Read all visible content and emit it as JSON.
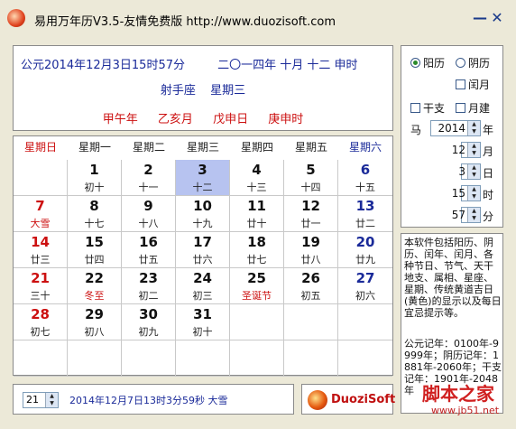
{
  "window": {
    "title": "易用万年历V3.5-友情免费版 http://www.duozisoft.com",
    "minimize": "—",
    "close": "✕"
  },
  "info": {
    "solar_datetime": "公元2014年12月3日15时57分",
    "lunar_date": "二〇一四年 十月 十二 申时",
    "constellation": "射手座",
    "weekday": "星期三",
    "ganzhi": [
      "甲午年",
      "乙亥月",
      "戊申日",
      "庚申时"
    ]
  },
  "weekdays": [
    "星期日",
    "星期一",
    "星期二",
    "星期三",
    "星期四",
    "星期五",
    "星期六"
  ],
  "calendar": {
    "today": "3",
    "days": [
      {
        "d": "",
        "l": ""
      },
      {
        "d": "1",
        "l": "初十"
      },
      {
        "d": "2",
        "l": "十一"
      },
      {
        "d": "3",
        "l": "十二"
      },
      {
        "d": "4",
        "l": "十三"
      },
      {
        "d": "5",
        "l": "十四"
      },
      {
        "d": "6",
        "l": "十五"
      },
      {
        "d": "7",
        "l": "大雪"
      },
      {
        "d": "8",
        "l": "十七"
      },
      {
        "d": "9",
        "l": "十八"
      },
      {
        "d": "10",
        "l": "十九"
      },
      {
        "d": "11",
        "l": "廿十"
      },
      {
        "d": "12",
        "l": "廿一"
      },
      {
        "d": "13",
        "l": "廿二"
      },
      {
        "d": "14",
        "l": "廿三"
      },
      {
        "d": "15",
        "l": "廿四"
      },
      {
        "d": "16",
        "l": "廿五"
      },
      {
        "d": "17",
        "l": "廿六"
      },
      {
        "d": "18",
        "l": "廿七"
      },
      {
        "d": "19",
        "l": "廿八"
      },
      {
        "d": "20",
        "l": "廿九"
      },
      {
        "d": "21",
        "l": "三十"
      },
      {
        "d": "22",
        "l": "冬至"
      },
      {
        "d": "23",
        "l": "初二"
      },
      {
        "d": "24",
        "l": "初三"
      },
      {
        "d": "25",
        "l": "圣诞节"
      },
      {
        "d": "26",
        "l": "初五"
      },
      {
        "d": "27",
        "l": "初六"
      },
      {
        "d": "28",
        "l": "初七"
      },
      {
        "d": "29",
        "l": "初八"
      },
      {
        "d": "30",
        "l": "初九"
      },
      {
        "d": "31",
        "l": "初十"
      },
      {
        "d": "",
        "l": ""
      },
      {
        "d": "",
        "l": ""
      },
      {
        "d": "",
        "l": ""
      },
      {
        "d": "",
        "l": ""
      },
      {
        "d": "",
        "l": ""
      },
      {
        "d": "",
        "l": ""
      },
      {
        "d": "",
        "l": ""
      },
      {
        "d": "",
        "l": ""
      },
      {
        "d": "",
        "l": ""
      },
      {
        "d": "",
        "l": ""
      }
    ],
    "festival_labels": [
      "大雪",
      "冬至",
      "圣诞节"
    ]
  },
  "bottom": {
    "offset_value": "21",
    "event_text": "2014年12月7日13时3分59秒 大雪",
    "logo_text": "DuoziSoft"
  },
  "controls": {
    "solar_label": "阳历",
    "lunar_label": "阴历",
    "leap_month_label": "闰月",
    "ganzhi_label": "干支",
    "jian_label": "月建",
    "zodiac_label": "马",
    "year_value": "2014",
    "year_unit": "年",
    "month_value": "12",
    "month_unit": "月",
    "day_value": "3",
    "day_unit": "日",
    "hour_value": "15",
    "hour_unit": "时",
    "minute_value": "57",
    "minute_unit": "分"
  },
  "description": {
    "text1": "本软件包括阳历、阴历、闰年、闰月、各种节日、节气、天干地支、属相、星座、星期、传统黄道吉日(黄色)的显示以及每日宜忌提示等。",
    "text2": "公元记年：0100年-9999年；阴历记年：1881年-2060年；干支记年：1901年-2048年"
  },
  "watermark": {
    "title": "脚本之家",
    "url": "www.jb51.net"
  }
}
